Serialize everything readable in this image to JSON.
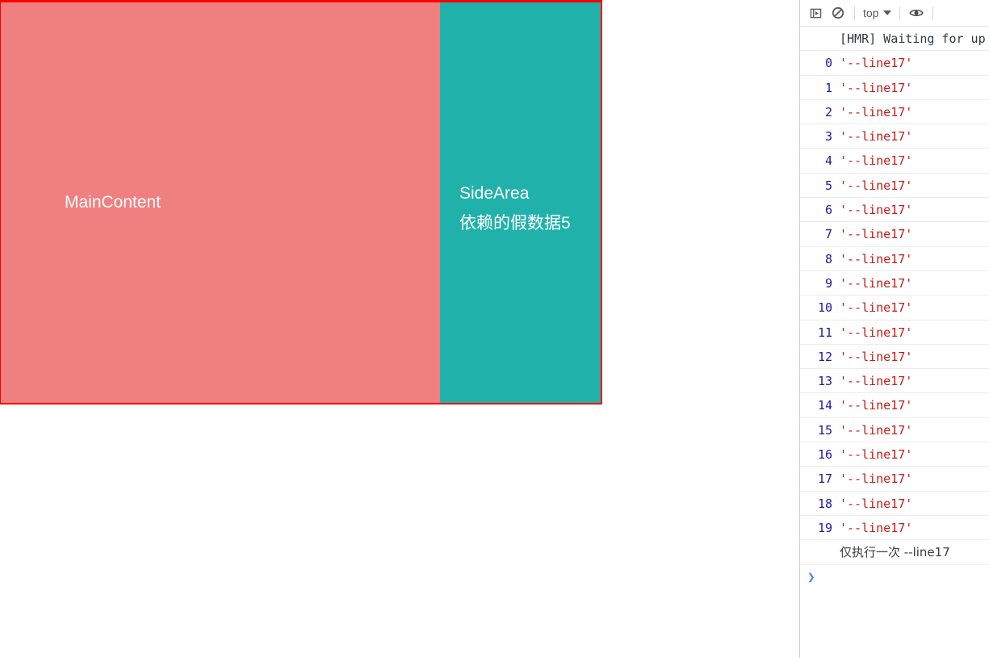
{
  "page": {
    "main_content": {
      "label": "MainContent"
    },
    "side_area": {
      "title": "SideArea",
      "subtitle": "依赖的假数据5"
    },
    "colors": {
      "main_bg": "#f08080",
      "side_bg": "#20b2aa",
      "container_border": "#ff0000",
      "text": "#ffffff"
    }
  },
  "devtools": {
    "toolbar": {
      "sidebar_toggle": "show-console-sidebar-icon",
      "clear_console": "clear-console-icon",
      "context_select": "top",
      "eye_label": "live-expression-icon"
    },
    "messages": [
      {
        "idx": "",
        "text": "[HMR] Waiting for up",
        "kind": "plain"
      },
      {
        "idx": "0",
        "text": "'--line17'",
        "kind": "string"
      },
      {
        "idx": "1",
        "text": "'--line17'",
        "kind": "string"
      },
      {
        "idx": "2",
        "text": "'--line17'",
        "kind": "string"
      },
      {
        "idx": "3",
        "text": "'--line17'",
        "kind": "string"
      },
      {
        "idx": "4",
        "text": "'--line17'",
        "kind": "string"
      },
      {
        "idx": "5",
        "text": "'--line17'",
        "kind": "string"
      },
      {
        "idx": "6",
        "text": "'--line17'",
        "kind": "string"
      },
      {
        "idx": "7",
        "text": "'--line17'",
        "kind": "string"
      },
      {
        "idx": "8",
        "text": "'--line17'",
        "kind": "string"
      },
      {
        "idx": "9",
        "text": "'--line17'",
        "kind": "string"
      },
      {
        "idx": "10",
        "text": "'--line17'",
        "kind": "string"
      },
      {
        "idx": "11",
        "text": "'--line17'",
        "kind": "string"
      },
      {
        "idx": "12",
        "text": "'--line17'",
        "kind": "string"
      },
      {
        "idx": "13",
        "text": "'--line17'",
        "kind": "string"
      },
      {
        "idx": "14",
        "text": "'--line17'",
        "kind": "string"
      },
      {
        "idx": "15",
        "text": "'--line17'",
        "kind": "string"
      },
      {
        "idx": "16",
        "text": "'--line17'",
        "kind": "string"
      },
      {
        "idx": "17",
        "text": "'--line17'",
        "kind": "string"
      },
      {
        "idx": "18",
        "text": "'--line17'",
        "kind": "string"
      },
      {
        "idx": "19",
        "text": "'--line17'",
        "kind": "string"
      },
      {
        "idx": "",
        "text": "仅执行一次 --line17",
        "kind": "cn"
      }
    ],
    "prompt": {
      "arrow": "❯"
    }
  }
}
